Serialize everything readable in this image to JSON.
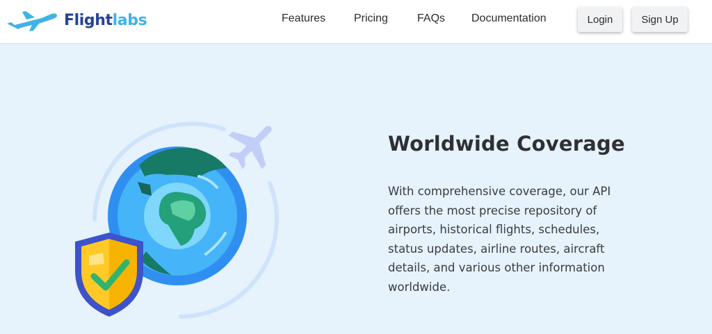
{
  "nav": {
    "brand_part1": "Flight",
    "brand_part2": "labs",
    "links": [
      "Features",
      "Pricing",
      "FAQs",
      "Documentation"
    ],
    "login_label": "Login",
    "signup_label": "Sign Up"
  },
  "hero": {
    "title": "Worldwide Coverage",
    "description": "With comprehensive coverage, our API offers the most precise repository of airports, historical flights, schedules, status updates, airline routes, aircraft details, and various other information worldwide."
  },
  "colors": {
    "brand_dark": "#23439a",
    "brand_light": "#3fb3e6",
    "page_bg": "#e6f2fc"
  },
  "icons": [
    "airplane-logo-icon",
    "globe-icon",
    "shield-check-icon",
    "airplane-icon"
  ]
}
